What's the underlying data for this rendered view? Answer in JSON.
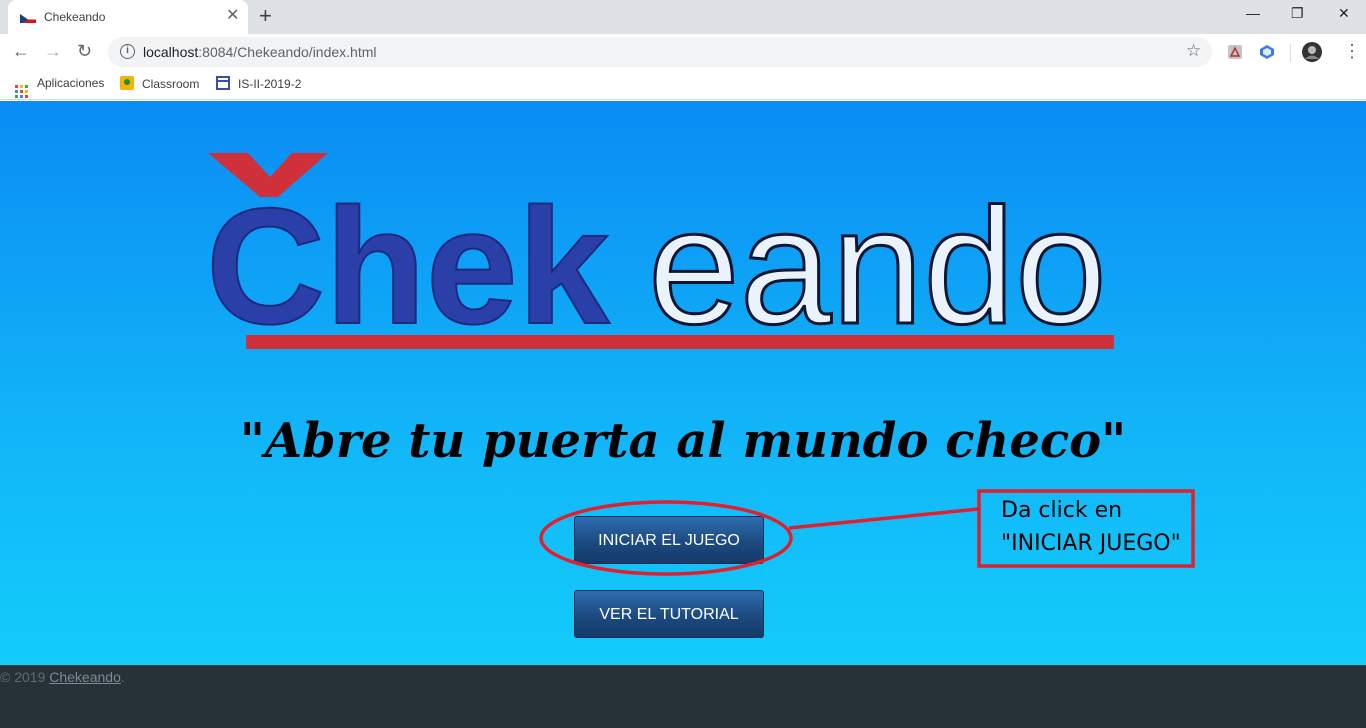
{
  "browser": {
    "tab_title": "Chekeando",
    "url_host": "localhost",
    "url_rest": ":8084/Chekeando/index.html",
    "bookmarks": [
      {
        "label": "Aplicaciones",
        "icon": "apps-grid-icon"
      },
      {
        "label": "Classroom",
        "icon": "classroom-icon"
      },
      {
        "label": "IS-II-2019-2",
        "icon": "calendar-icon"
      }
    ]
  },
  "page": {
    "logo_dark": "Chek",
    "logo_light": "eando",
    "slogan": "\"Abre tu puerta al mundo checo\"",
    "start_button": "INICIAR EL JUEGO",
    "tutorial_button": "VER EL TUTORIAL"
  },
  "annotation": {
    "line1": "Da click en",
    "line2": "\"INICIAR JUEGO\"",
    "color": "#e0202e"
  },
  "footer": {
    "copyright": "© 2019 ",
    "link": "Chekeando",
    "period": "."
  },
  "colors": {
    "logo_blue": "#2b3fa8",
    "logo_red": "#d0303a",
    "page_bg_top": "#0a8cf4",
    "page_bg_bottom": "#12ccfb",
    "footer_bg": "#263238"
  }
}
